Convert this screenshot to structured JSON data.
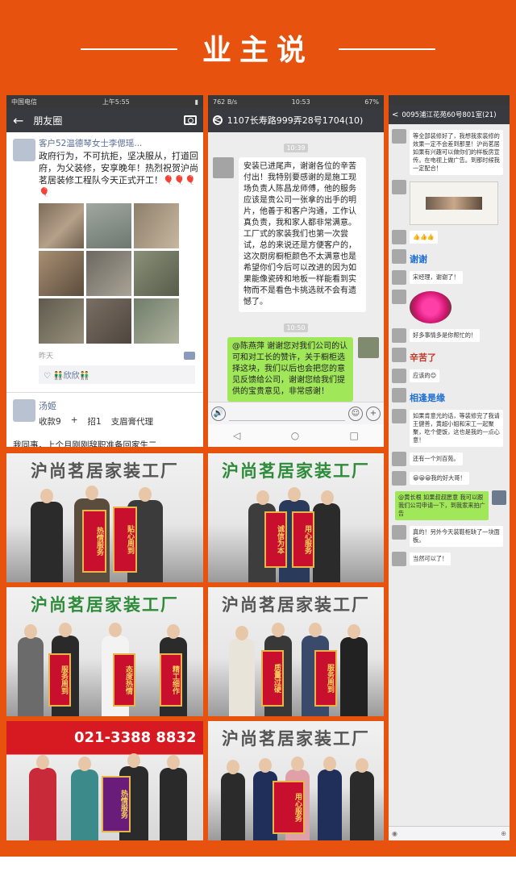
{
  "header": {
    "title": "业主说"
  },
  "moments": {
    "status": {
      "carrier": "中国电信",
      "time": "上午5:55",
      "battery": ""
    },
    "nav": {
      "back": "←",
      "title": "朋友圈"
    },
    "post1": {
      "author": "客户52温德琴女士李偲瑶...",
      "text": "政府行为，不可抗拒，坚决服从，打道回府，为父装修，安享晚年！热烈祝贺沪尚茗居装修工程队今天正式开工！",
      "emoji": "🎈🎈🎈🎈",
      "time": "昨天",
      "likes": "♡ 👬欣欣👬"
    },
    "post2": {
      "author": "汤姬",
      "collect": "收款",
      "collect_badge": "9",
      "plus": "+",
      "recruit": "招",
      "recruit_badge": "1",
      "agent": "支眉膏代理",
      "text": "我同事，上个月刚刚辞职准备回家生二"
    }
  },
  "chat": {
    "status": {
      "left": "762 B/s",
      "time": "10:53",
      "battery": "67%"
    },
    "nav": {
      "back": "<",
      "title": "1107长寿路999弄28号1704(10)"
    },
    "ts1": "10:39",
    "msg_left": "安装已进尾声，谢谢各位的辛苦付出！我特别要感谢的是施工现场负责人陈昌龙师傅，他的服务应该是贵公司一张拿的出手的明片，他善于和客户沟通，工作认真负责，我和家人都非常满意。工厂式的家装我们也第一次尝试，总的来说还是方便客户的，这次厨房橱柜颜色不太满意也是希望你们今后可以改进的因为如果能像瓷砖和地板一样能看到实物而不是看色卡挑选就不会有遗憾了。",
    "ts2": "10:50",
    "msg_right": "@陈燕萍 谢谢您对我们公司的认可和对工长的赞许，关于橱柜选择这块，我们以后也会把您的意见反馈给公司，谢谢您给我们提供的宝贵意见，非常感谢！",
    "voice_icon": "🔊",
    "emoji_icon": "☺",
    "plus_icon": "+",
    "sys": [
      "◁",
      "○",
      "□"
    ]
  },
  "group": {
    "status": "",
    "nav": {
      "back": "<",
      "title": "0095浦江花苑60号801室(21)"
    },
    "messages": [
      {
        "side": "l",
        "name": "",
        "text": "等全部装修好了，我想我家装修的效果一定不会差到那里！沪尚茗居如果有兴趣可以做你们的样板房宣传。在电视上做广告。到那时候我一定配合！"
      },
      {
        "side": "l",
        "name": "",
        "image": "frame"
      },
      {
        "side": "l",
        "name": "",
        "text": "👍👍👍"
      },
      {
        "side": "l",
        "name": "",
        "sticker": "谢谢"
      },
      {
        "side": "l",
        "name": "",
        "text": "宋经理，谢谢了！"
      },
      {
        "side": "l",
        "name": "",
        "image": "flower"
      },
      {
        "side": "l",
        "name": "",
        "text": "好多事情多是你帮忙的！"
      },
      {
        "side": "l",
        "name": "",
        "sticker": "辛苦了"
      },
      {
        "side": "l",
        "name": "",
        "text": "应该的😊"
      },
      {
        "side": "l",
        "name": "",
        "sticker": "相逢是缘"
      },
      {
        "side": "l",
        "name": "",
        "text": "如果肯意光的话，等装修完了我请王健善，黄超小姐和宋工一起聚聚，吃个便饭，这也是我的一点心意！"
      },
      {
        "side": "l",
        "name": "",
        "text": "还有一个刘百苑。"
      },
      {
        "side": "l",
        "name": "",
        "text": "😀😀😀我的好大哥！"
      },
      {
        "side": "r",
        "name": "",
        "text": "@黄长根 如果叔叔愿意 我可以跟我们公司申请一下，到我家来拍广告"
      },
      {
        "side": "l",
        "name": "",
        "text": "真的！另外今天装鞋柜缺了一块面板。"
      },
      {
        "side": "l",
        "name": "",
        "text": "当然可以了！"
      }
    ]
  },
  "photos": {
    "sign": "沪尚茗居家装工厂",
    "hotline": "021-3388 8832",
    "banners": [
      [
        "热情服务",
        "贴心周到"
      ],
      [
        "诚信为本",
        "用心服务"
      ],
      [
        "服务周到",
        "态度热情"
      ],
      [
        "精工细作",
        "质量过硬"
      ]
    ]
  }
}
